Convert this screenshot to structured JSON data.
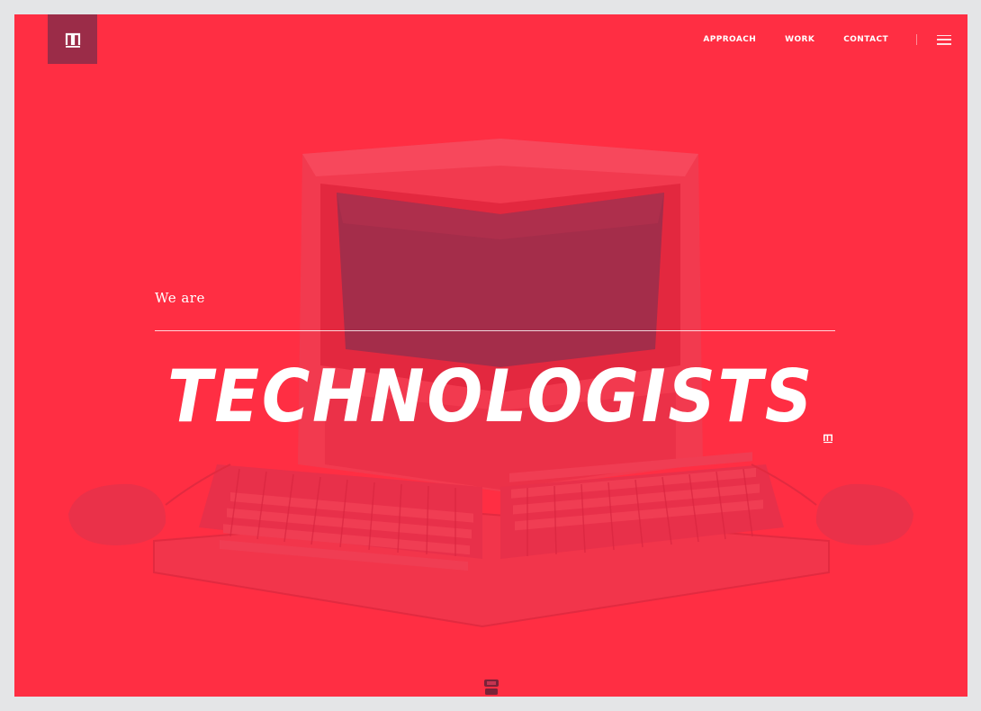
{
  "header": {
    "logo_icon": "monogram-logo-icon",
    "nav": [
      {
        "label": "APPROACH"
      },
      {
        "label": "WORK"
      },
      {
        "label": "CONTACT"
      }
    ],
    "menu_icon": "hamburger-menu-icon"
  },
  "hero": {
    "intro": "We are",
    "headline": "TECHNOLOGISTS",
    "background_subject": "retro computer with mirrored keyboards and mice",
    "scroll_icon": "scroll-down-icon"
  },
  "colors": {
    "page_background": "#e4e5e7",
    "hero_red": "#ff2e43",
    "logo_box": "#9b2c48",
    "text": "#ffffff"
  }
}
